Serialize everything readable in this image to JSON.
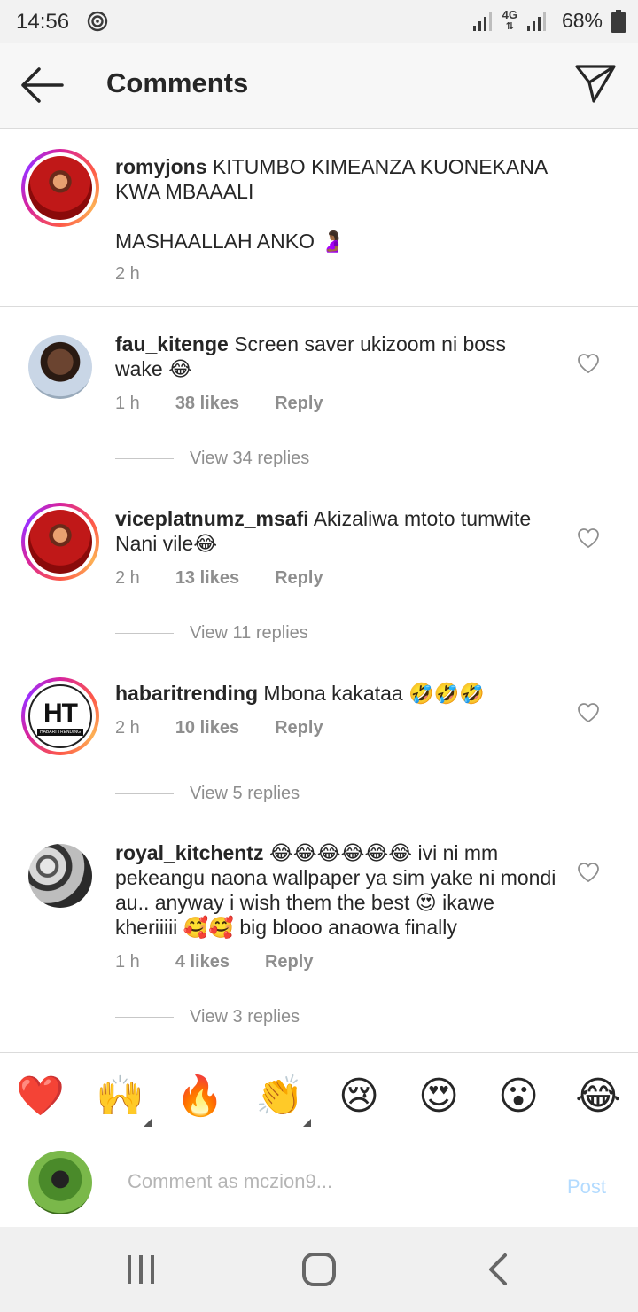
{
  "status_bar": {
    "time": "14:56",
    "network": "4G",
    "battery": "68%",
    "icons": [
      "cast-icon",
      "signal-icon",
      "battery-icon"
    ]
  },
  "header": {
    "title": "Comments",
    "back_icon": "back-arrow-icon",
    "send_icon": "paper-plane-icon"
  },
  "caption": {
    "username": "romyjons",
    "text_line1": " KITUMBO KIMEANZA KUONEKANA KWA MBAAALI",
    "text_line2": "MASHAALLAH ANKO 🤰🏾",
    "time": "2 h"
  },
  "comments": [
    {
      "username": "fau_kitenge",
      "text": " Screen saver ukizoom ni boss wake 😂",
      "time": "1 h",
      "likes": "38 likes",
      "reply": "Reply",
      "view_replies": "View 34 replies"
    },
    {
      "username": "viceplatnumz_msafi",
      "text": " Akizaliwa mtoto tumwite Nani vile😂",
      "time": "2 h",
      "likes": "13 likes",
      "reply": "Reply",
      "view_replies": "View 11 replies"
    },
    {
      "username": "habaritrending",
      "text": " Mbona kakataa 🤣🤣🤣",
      "time": "2 h",
      "likes": "10 likes",
      "reply": "Reply",
      "view_replies": "View 5 replies",
      "avatar_text": "HT",
      "avatar_sub": "HABARI TRENDING"
    },
    {
      "username": "royal_kitchentz",
      "text": " 😂😂😂😂😂😂 ivi ni mm pekeangu naona wallpaper ya sim yake ni mondi au.. anyway i wish them the best 😍 ikawe kheriiiii 🥰🥰 big blooo anaowa finally",
      "time": "1 h",
      "likes": "4 likes",
      "reply": "Reply",
      "view_replies": "View 3 replies"
    }
  ],
  "reactions": [
    "❤️",
    "🙌",
    "🔥",
    "👏",
    "😢",
    "😍",
    "😮",
    "😂"
  ],
  "composer": {
    "placeholder": "Comment as mczion9...",
    "post_label": "Post"
  },
  "colors": {
    "accent_blue_disabled": "#b3dbff",
    "meta_gray": "#8e8e8e",
    "text": "#262626"
  }
}
